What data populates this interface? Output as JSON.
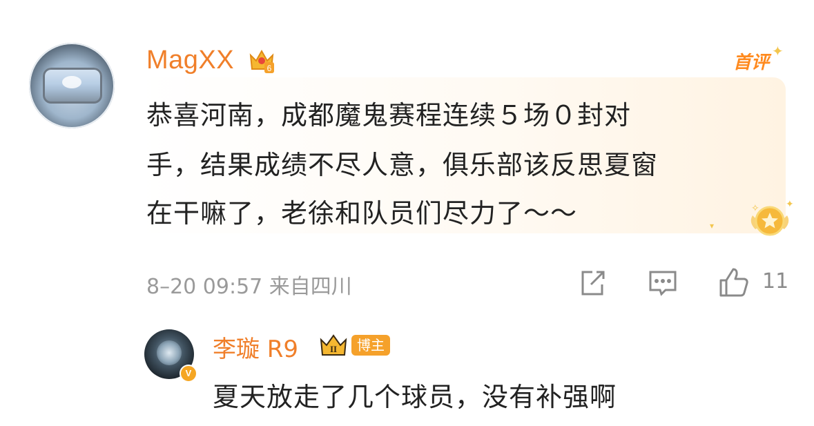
{
  "comment": {
    "username": "MagXX",
    "user_level": "6",
    "first_comment_tag": "首评",
    "lines": [
      "恭喜河南，成都魔鬼赛程连续５场０封对",
      "手，结果成绩不尽人意，俱乐部该反思夏窗",
      "在干嘛了，老徐和队员们尽力了～～"
    ],
    "time_location": "8–20 09:57 来自四川",
    "like_count": "11"
  },
  "reply": {
    "username": "李璇 R9",
    "badge_level": "II",
    "host_tag": "博主",
    "verified_mark": "V",
    "text": "夏天放走了几个球员，没有补强啊"
  },
  "icons": {
    "share": "share-icon",
    "reply": "comment-icon",
    "like": "thumbs-up-icon",
    "crown": "crown-icon",
    "medal": "star-medal-icon"
  },
  "colors": {
    "username": "#f07f2a",
    "accent_orange": "#ff8a1e",
    "meta_gray": "#9a9a9a",
    "text": "#222222"
  }
}
